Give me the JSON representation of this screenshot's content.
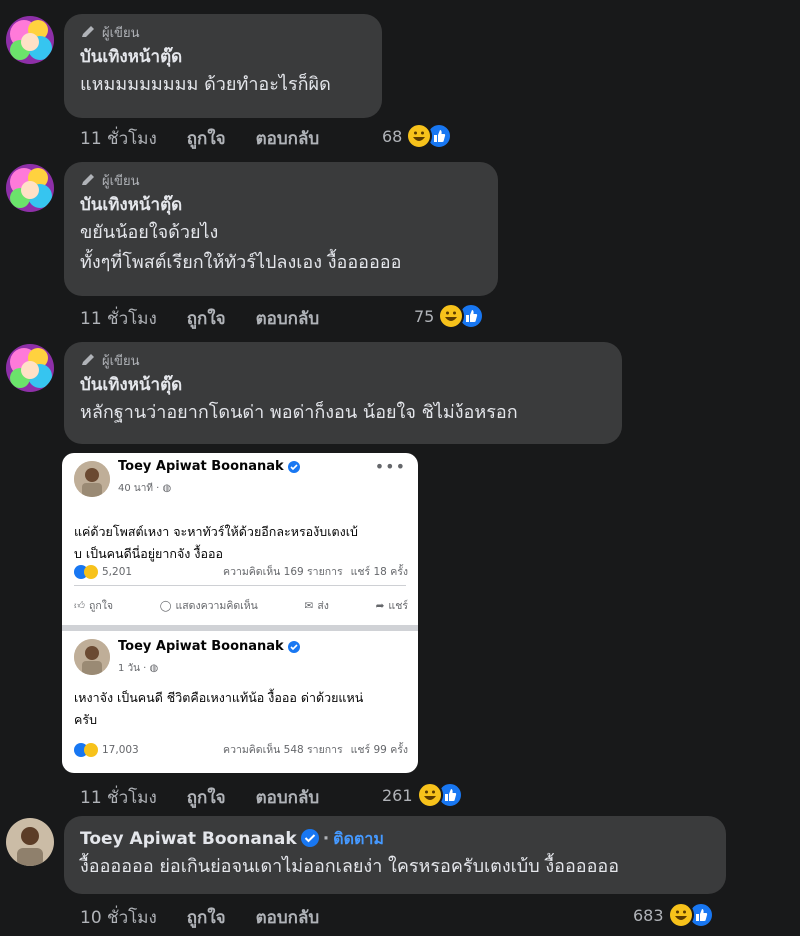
{
  "comments": [
    {
      "badge": "ผู้เขียน",
      "name": "บันเทิงหน้าตุ๊ด",
      "lines": [
        "แหมมมมมมมม ด้วยทำอะไรก็ผิด"
      ],
      "time": "11 ชั่วโมง",
      "like": "ถูกใจ",
      "reply": "ตอบกลับ",
      "reaction_count": "68"
    },
    {
      "badge": "ผู้เขียน",
      "name": "บันเทิงหน้าตุ๊ด",
      "lines": [
        "ขยันน้อยใจด้วยไง",
        "ทั้งๆที่โพสต์เรียกให้ทัวร์ไปลงเอง งื้ออออออ"
      ],
      "time": "11 ชั่วโมง",
      "like": "ถูกใจ",
      "reply": "ตอบกลับ",
      "reaction_count": "75"
    },
    {
      "badge": "ผู้เขียน",
      "name": "บันเทิงหน้าตุ๊ด",
      "lines": [
        "หลักฐานว่าอยากโดนด่า พอด่าก็งอน น้อยใจ ชิไม่ง้อหรอก"
      ],
      "time": "11 ชั่วโมง",
      "like": "ถูกใจ",
      "reply": "ตอบกลับ",
      "reaction_count": "261"
    },
    {
      "name": "Toey Apiwat Boonanak",
      "follow": "ติดตาม",
      "separator": "·",
      "lines": [
        "งื้ออออออ ย่อเกินย่อจนเดาไม่ออกเลยง่า ใครหรอครับเตงเบ้บ งื้ออออออ"
      ],
      "time": "10 ชั่วโมง",
      "like": "ถูกใจ",
      "reply": "ตอบกลับ",
      "reaction_count": "683"
    }
  ],
  "screenshot": {
    "posts": [
      {
        "name": "Toey Apiwat Boonanak",
        "meta": "40 นาที · ",
        "body": [
          "แค่ด้วยโพสต์เหงา จะหาทัวร์ให้ด้วยอีกละหรองับเตงเบ้",
          "บ เป็นคนดีนี่อยู่ยากจัง งื้อออ"
        ],
        "reactions": "5,201",
        "comments": "ความคิดเห็น 169 รายการ",
        "shares": "แชร์ 18 ครั้ง",
        "actions": [
          "ถูกใจ",
          "แสดงความคิดเห็น",
          "ส่ง",
          "แชร์"
        ]
      },
      {
        "name": "Toey Apiwat Boonanak",
        "meta": "1 วัน · ",
        "body": [
          "เหงาจัง เป็นคนดี ชีวิตคือเหงาแท้น้อ งื้อออ ด่าด้วยแหน่",
          "ครับ"
        ],
        "reactions": "17,003",
        "comments": "ความคิดเห็น 548 รายการ",
        "shares": "แชร์ 99 ครั้ง"
      }
    ],
    "dots": "•••"
  },
  "colors": {
    "background": "#18191a",
    "bubble": "#3a3b3c",
    "link_blue": "#4599ff",
    "fb_blue": "#1877f2",
    "haha_yellow": "#f7c21b"
  }
}
